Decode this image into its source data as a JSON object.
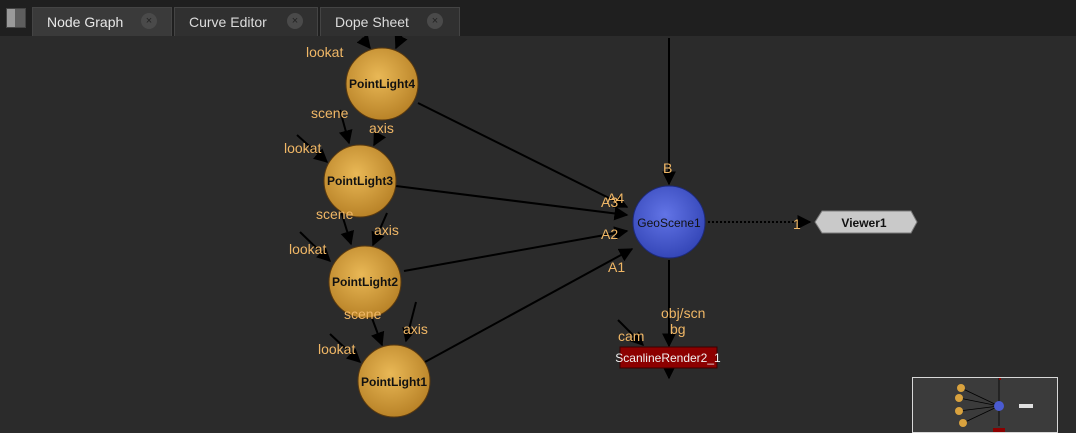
{
  "tabs": [
    {
      "label": "Node Graph",
      "close": "×"
    },
    {
      "label": "Curve Editor",
      "close": "×"
    },
    {
      "label": "Dope Sheet",
      "close": "×"
    }
  ],
  "nodes": {
    "pointlight4": "PointLight4",
    "pointlight3": "PointLight3",
    "pointlight2": "PointLight2",
    "pointlight1": "PointLight1",
    "geoscene": "GeoScene1",
    "viewer": "Viewer1",
    "scanline": "ScanlineRender2_1"
  },
  "pins": {
    "lookat": "lookat",
    "scene": "scene",
    "axis": "axis",
    "B": "B",
    "A4": "A4",
    "A3": "A3",
    "A2": "A2",
    "A1": "A1",
    "viewer_in": "1",
    "obj_scn": "obj/scn",
    "bg": "bg",
    "cam": "cam"
  },
  "colors": {
    "light_node": "#d9a23e",
    "geo_node": "#4a5bd1",
    "render_node": "#8c0000",
    "viewer_node": "#c8c8c8",
    "pin_label": "#f0b766"
  }
}
